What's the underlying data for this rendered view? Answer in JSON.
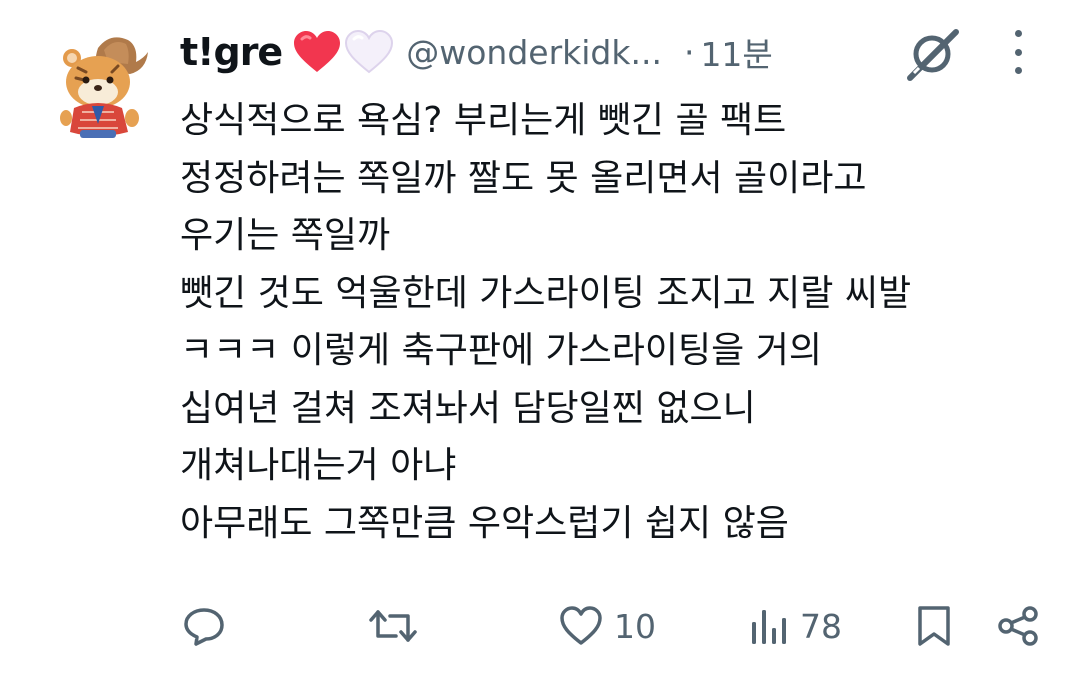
{
  "tweet": {
    "display_name": "t!gre",
    "handle": "@wonderkidk...",
    "separator": "·",
    "time": "11분",
    "lines": [
      "상식적으로 욕심? 부리는게 뺏긴 골 팩트",
      "정정하려는 쪽일까 짤도 못 올리면서 골이라고",
      "우기는 쪽일까",
      "뺏긴 것도 억울한데 가스라이팅 조지고 지랄 씨발",
      "ㅋㅋㅋ 이렇게 축구판에 가스라이팅을 거의",
      "십여년 걸쳐 조져놔서 담당일찐 없으니",
      "개쳐나대는거 아냐",
      "아무래도 그쪽만큼 우악스럽기 쉽지 않음"
    ]
  },
  "actions": {
    "reply": {
      "icon": "reply-icon"
    },
    "retweet": {
      "icon": "retweet-icon"
    },
    "like": {
      "icon": "heart-outline-icon",
      "count": "10"
    },
    "views": {
      "icon": "analytics-icon",
      "count": "78"
    },
    "bookmark": {
      "icon": "bookmark-icon"
    },
    "share": {
      "icon": "share-icon"
    }
  },
  "colors": {
    "text": "#0f1419",
    "secondary": "#536471",
    "heart_red": "#f2364f",
    "heart_white": "#f4f0fa"
  }
}
